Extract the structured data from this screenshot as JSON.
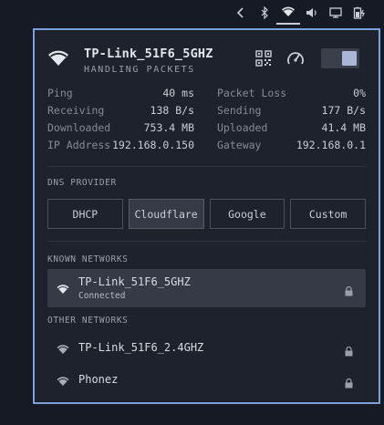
{
  "topbar": {
    "icons": [
      "chevron-left-icon",
      "bluetooth-icon",
      "wifi-icon",
      "volume-icon",
      "monitor-icon",
      "battery-icon"
    ]
  },
  "panel": {
    "ssid": "TP-Link_51F6_5GHZ",
    "status": "HANDLING PACKETS",
    "toggle_on": true,
    "stats": [
      {
        "l1": "Ping",
        "v1": "40 ms",
        "l2": "Packet Loss",
        "v2": "0%"
      },
      {
        "l1": "Receiving",
        "v1": "138 B/s",
        "l2": "Sending",
        "v2": "177 B/s"
      },
      {
        "l1": "Downloaded",
        "v1": "753.4 MB",
        "l2": "Uploaded",
        "v2": "41.4 MB"
      },
      {
        "l1": "IP Address",
        "v1": "192.168.0.150",
        "l2": "Gateway",
        "v2": "192.168.0.1"
      }
    ],
    "dns": {
      "label": "DNS PROVIDER",
      "options": [
        "DHCP",
        "Cloudflare",
        "Google",
        "Custom"
      ],
      "selected": "Cloudflare"
    },
    "known": {
      "label": "KNOWN NETWORKS",
      "networks": [
        {
          "name": "TP-Link_51F6_5GHZ",
          "status": "Connected"
        }
      ]
    },
    "other": {
      "label": "OTHER NETWORKS",
      "networks": [
        {
          "name": "TP-Link_51F6_2.4GHZ"
        },
        {
          "name": "Phonez"
        }
      ]
    }
  },
  "colors": {
    "accent_border": "#7aa2d8",
    "panel_bg": "#1e222c",
    "selected_bg": "#353a46",
    "toggle_knob": "#aab6d8"
  }
}
